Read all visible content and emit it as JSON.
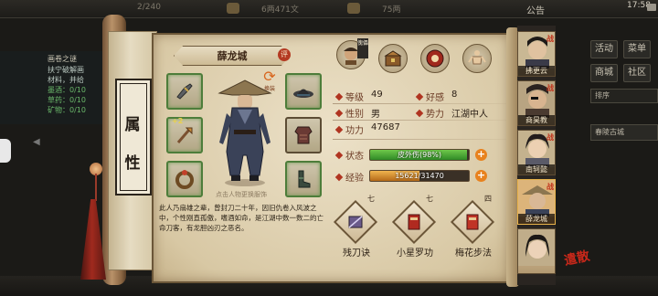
{
  "topbar": {
    "stat_left": "2/240",
    "money": "6两471文",
    "gold": "75两",
    "announce": "公告",
    "clock": "17:58"
  },
  "quest": {
    "title": "画卷之谜",
    "lines": [
      "扶宁破解画",
      "材料，并给",
      "墨酒：0/10",
      "草药：0/10",
      "矿物：0/10"
    ]
  },
  "scroll": {
    "chars": [
      "属",
      "性"
    ]
  },
  "right_menu": {
    "buttons": [
      "活动",
      "菜单",
      "商城",
      "社区"
    ],
    "sort_label": "排序",
    "city_label": "春陵古城"
  },
  "character": {
    "name": "薛龙城",
    "rate_badge": "评",
    "swap_label": "换装",
    "caption": "点击人物更换服饰",
    "description": "此人乃扇雄之辈，曾封刀二十年，因旧仇卷入风波之中，个性刚直孤傲，嗜酒如命，是江湖中数一数二的亡命刀客，有龙胆凶刃之恶名。",
    "equip_plus": "+2",
    "portrait_tag": "傀儡"
  },
  "stats": {
    "level_label": "等级",
    "level_value": "49",
    "favor_label": "好感",
    "favor_value": "8",
    "gender_label": "性别",
    "gender_value": "男",
    "faction_label": "势力",
    "faction_value": "江湖中人",
    "power_label": "功力",
    "power_value": "47687",
    "state_label": "状态",
    "state_text": "皮外伤(98%)",
    "state_pct": 98,
    "exp_label": "经验",
    "exp_text": "15621/31470",
    "exp_pct": 49.6
  },
  "skills": [
    {
      "level": "七",
      "name": "残刀诀"
    },
    {
      "level": "七",
      "name": "小星罗功"
    },
    {
      "level": "四",
      "name": "梅花步法"
    }
  ],
  "roster": [
    {
      "name": "拂更云",
      "mark": "战"
    },
    {
      "name": "商昊教",
      "mark": "战"
    },
    {
      "name": "南轲懿",
      "mark": "战"
    },
    {
      "name": "薛龙城",
      "mark": "战"
    },
    {
      "name": "",
      "mark": ""
    }
  ],
  "dismiss_label": "遣散",
  "colors": {
    "panel": "#e6dbc1",
    "accent_red": "#b03420",
    "state_green": "#3a9a2c",
    "exp_orange": "#d88a2a"
  }
}
